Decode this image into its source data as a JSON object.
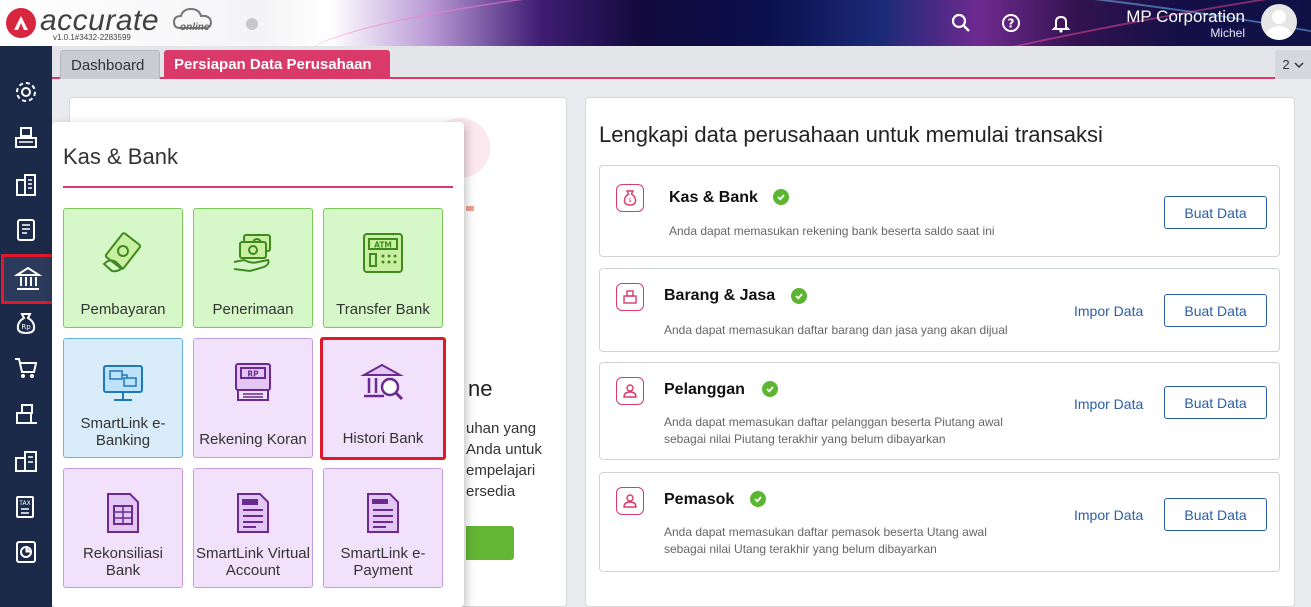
{
  "header": {
    "brand": "accurate",
    "brand_sub": "online",
    "version": "v1.0.1#3432-2283599",
    "company": "MP Corporation",
    "user": "Michel",
    "icons": [
      "search-icon",
      "help-icon",
      "bell-icon",
      "avatar"
    ]
  },
  "sidebar": {
    "items": [
      {
        "icon": "gear-icon"
      },
      {
        "icon": "cash-register-icon"
      },
      {
        "icon": "building-icon"
      },
      {
        "icon": "ledger-icon"
      },
      {
        "icon": "bank-icon",
        "active": true
      },
      {
        "icon": "money-bag-icon"
      },
      {
        "icon": "cart-icon"
      },
      {
        "icon": "inventory-icon"
      },
      {
        "icon": "company-icon"
      },
      {
        "icon": "tax-icon"
      },
      {
        "icon": "report-icon"
      }
    ]
  },
  "tabs": [
    {
      "label": "Dashboard"
    },
    {
      "label": "Persiapan Data Perusahaan",
      "active": true
    }
  ],
  "tab_count": "2",
  "left_panel": {
    "heading_fragment": "ne",
    "text_lines": [
      "uhan yang",
      "Anda untuk",
      "empelajari",
      "ersedia"
    ]
  },
  "right_panel": {
    "title": "Lengkapi data perusahaan untuk memulai transaksi",
    "cards": [
      {
        "title": "Kas & Bank",
        "desc": [
          "Anda dapat memasukan rekening bank beserta saldo saat ini"
        ],
        "primary": "Buat Data",
        "secondary": ""
      },
      {
        "title": "Barang & Jasa",
        "desc": [
          "Anda dapat memasukan daftar barang dan jasa yang akan dijual"
        ],
        "primary": "Buat Data",
        "secondary": "Impor Data"
      },
      {
        "title": "Pelanggan",
        "desc": [
          "Anda dapat memasukan daftar pelanggan beserta Piutang awal",
          "sebagai nilai Piutang terakhir yang belum dibayarkan"
        ],
        "primary": "Buat Data",
        "secondary": "Impor Data"
      },
      {
        "title": "Pemasok",
        "desc": [
          "Anda dapat memasukan daftar pemasok beserta Utang awal",
          "sebagai nilai Utang terakhir yang belum dibayarkan"
        ],
        "primary": "Buat Data",
        "secondary": "Impor Data"
      }
    ]
  },
  "popup": {
    "title": "Kas & Bank",
    "tiles": [
      {
        "label": "Pembayaran",
        "icon": "payment-icon",
        "color": "green"
      },
      {
        "label": "Penerimaan",
        "icon": "receipt-icon",
        "color": "green"
      },
      {
        "label": "Transfer Bank",
        "icon": "atm-icon",
        "color": "green"
      },
      {
        "label": "SmartLink e-Banking",
        "icon": "ebanking-icon",
        "color": "blue"
      },
      {
        "label": "Rekening Koran",
        "icon": "bank-statement-icon",
        "color": "purple"
      },
      {
        "label": "Histori Bank",
        "icon": "bank-history-icon",
        "color": "purple",
        "selected": true
      },
      {
        "label": "Rekonsiliasi Bank",
        "icon": "reconciliation-icon",
        "color": "purple"
      },
      {
        "label": "SmartLink Virtual Account",
        "icon": "virtual-account-icon",
        "color": "purple"
      },
      {
        "label": "SmartLink e-Payment",
        "icon": "epayment-icon",
        "color": "purple"
      }
    ]
  },
  "colors": {
    "accent": "#d93a6a",
    "sidebar": "#1c2a4a",
    "link": "#2a5ea8",
    "success": "#5cb531",
    "highlight": "#e0182b"
  }
}
